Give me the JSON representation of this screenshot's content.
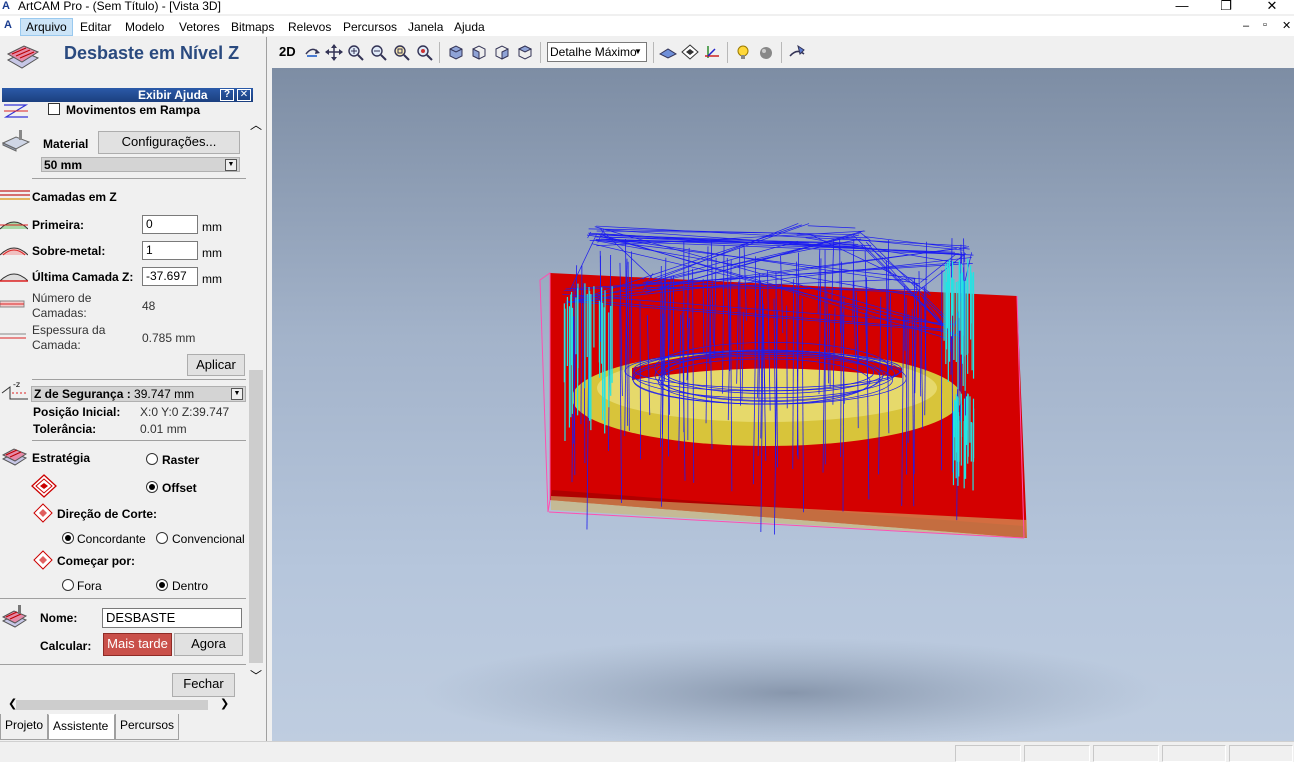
{
  "window": {
    "title": "ArtCAM Pro - (Sem Título) - [Vista 3D]",
    "app_icon_letter": "A",
    "controls": [
      "—",
      "❐",
      "✕"
    ],
    "mdi_controls": [
      "–",
      "▫",
      "✕"
    ]
  },
  "menu": [
    "Arquivo",
    "Editar",
    "Modelo",
    "Vetores",
    "Bitmaps",
    "Relevos",
    "Percursos",
    "Janela",
    "Ajuda"
  ],
  "panel": {
    "title": "Desbaste em Nível Z",
    "help_label": "Exibir Ajuda",
    "help_q": "?",
    "help_x": "✕",
    "ramp_label": "Movimentos em Rampa",
    "material_label": "Material",
    "material_button": "Configurações...",
    "material_value": "50 mm",
    "zlayers_label": "Camadas em Z",
    "first_label": "Primeira:",
    "first_value": "0",
    "overmetal_label": "Sobre-metal:",
    "overmetal_value": "1",
    "last_label": "Última Camada Z:",
    "last_value": "-37.697",
    "unit": "mm",
    "nlayers_label_1": "Número de",
    "nlayers_label_2": "Camadas:",
    "nlayers_value": "48",
    "thickness_label_1": "Espessura da",
    "thickness_label_2": "Camada:",
    "thickness_value": "0.785 mm",
    "apply_button": "Aplicar",
    "safez_label": "Z de Segurança :",
    "safez_value": "39.747 mm",
    "initpos_label": "Posição Inicial:",
    "initpos_value": "X:0 Y:0 Z:39.747",
    "tolerance_label": "Tolerância:",
    "tolerance_value": "0.01 mm",
    "strategy_label": "Estratégia",
    "raster_label": "Raster",
    "offset_label": "Offset",
    "cutdir_label": "Direção de Corte:",
    "climb_label": "Concordante",
    "conventional_label": "Convencional",
    "startby_label": "Começar por:",
    "outside_label": "Fora",
    "inside_label": "Dentro",
    "name_label": "Nome:",
    "name_value": "DESBASTE",
    "calc_label": "Calcular:",
    "later_button": "Mais tarde",
    "now_button": "Agora",
    "close_button": "Fechar",
    "scroll_left": "❮",
    "scroll_right": "❯",
    "scroll_up": "︿",
    "scroll_down": "﹀"
  },
  "tabs": [
    "Projeto",
    "Assistente",
    "Percursos"
  ],
  "toolbar": {
    "label_2d": "2D",
    "detail_value": "Detalhe Máximo"
  },
  "colors": {
    "accent_title": "#2a4a7f",
    "help_bar": "#1b3f7f",
    "later_button": "#c9504a",
    "model_red": "#d40000",
    "toolpath_blue": "#1c1cf0",
    "toolpath_cyan": "#24e3e3",
    "relief_yellow": "#d8c43a"
  }
}
